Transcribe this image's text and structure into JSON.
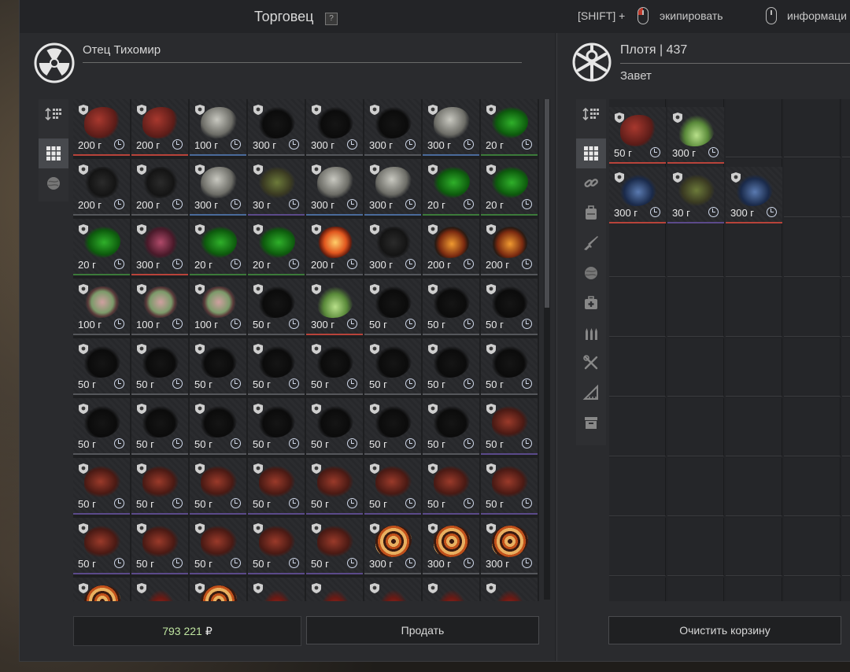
{
  "header": {
    "title": "Торговец",
    "help": "?",
    "hint_shift": "[SHIFT] +",
    "hint_equip": "экипировать",
    "hint_info": "информаци"
  },
  "trader": {
    "name": "Отец Тихомир"
  },
  "player": {
    "name": "Плотя | 437",
    "faction": "Завет"
  },
  "footer": {
    "money": "793 221",
    "currency": "₽",
    "sell_label": "Продать",
    "clear_label": "Очистить корзину"
  },
  "colors": {
    "accent_green": "#bfe5a0",
    "border_red": "#c0392b",
    "border_green": "#3c7a3a",
    "border_purple": "#5b4a8a"
  },
  "left_filters": [
    "sort-icon",
    "grid-icon",
    "artifact-icon"
  ],
  "right_filters": [
    "sort-icon",
    "grid-icon",
    "link-icon",
    "backpack-icon",
    "rifle-icon",
    "artifact-icon",
    "medkit-icon",
    "ammo-icon",
    "tools-icon",
    "misc-icon",
    "box-icon"
  ],
  "trader_items": [
    {
      "price": "200 г",
      "kind": "red"
    },
    {
      "price": "200 г",
      "kind": "red"
    },
    {
      "price": "100 г",
      "kind": "white"
    },
    {
      "price": "300 г",
      "kind": "black"
    },
    {
      "price": "300 г",
      "kind": "black"
    },
    {
      "price": "300 г",
      "kind": "black"
    },
    {
      "price": "300 г",
      "kind": "white"
    },
    {
      "price": "20 г",
      "kind": "green"
    },
    {
      "price": "200 г",
      "kind": "dark"
    },
    {
      "price": "200 г",
      "kind": "dark"
    },
    {
      "price": "300 г",
      "kind": "white"
    },
    {
      "price": "30 г",
      "kind": "moss"
    },
    {
      "price": "300 г",
      "kind": "white"
    },
    {
      "price": "300 г",
      "kind": "white"
    },
    {
      "price": "20 г",
      "kind": "green"
    },
    {
      "price": "20 г",
      "kind": "green"
    },
    {
      "price": "20 г",
      "kind": "green"
    },
    {
      "price": "300 г",
      "kind": "pink"
    },
    {
      "price": "20 г",
      "kind": "green"
    },
    {
      "price": "20 г",
      "kind": "green"
    },
    {
      "price": "200 г",
      "kind": "orange"
    },
    {
      "price": "300 г",
      "kind": "dark"
    },
    {
      "price": "200 г",
      "kind": "fire"
    },
    {
      "price": "200 г",
      "kind": "fire"
    },
    {
      "price": "100 г",
      "kind": "flower"
    },
    {
      "price": "100 г",
      "kind": "flower"
    },
    {
      "price": "100 г",
      "kind": "flower"
    },
    {
      "price": "50 г",
      "kind": "black"
    },
    {
      "price": "300 г",
      "kind": "crystal"
    },
    {
      "price": "50 г",
      "kind": "black"
    },
    {
      "price": "50 г",
      "kind": "black"
    },
    {
      "price": "50 г",
      "kind": "black"
    },
    {
      "price": "50 г",
      "kind": "black"
    },
    {
      "price": "50 г",
      "kind": "black"
    },
    {
      "price": "50 г",
      "kind": "black"
    },
    {
      "price": "50 г",
      "kind": "black"
    },
    {
      "price": "50 г",
      "kind": "black"
    },
    {
      "price": "50 г",
      "kind": "black"
    },
    {
      "price": "50 г",
      "kind": "black"
    },
    {
      "price": "50 г",
      "kind": "black"
    },
    {
      "price": "50 г",
      "kind": "black"
    },
    {
      "price": "50 г",
      "kind": "black"
    },
    {
      "price": "50 г",
      "kind": "black"
    },
    {
      "price": "50 г",
      "kind": "black"
    },
    {
      "price": "50 г",
      "kind": "black"
    },
    {
      "price": "50 г",
      "kind": "black"
    },
    {
      "price": "50 г",
      "kind": "black"
    },
    {
      "price": "50 г",
      "kind": "meat"
    },
    {
      "price": "50 г",
      "kind": "meat"
    },
    {
      "price": "50 г",
      "kind": "meat"
    },
    {
      "price": "50 г",
      "kind": "meat"
    },
    {
      "price": "50 г",
      "kind": "meat"
    },
    {
      "price": "50 г",
      "kind": "meat"
    },
    {
      "price": "50 г",
      "kind": "meat"
    },
    {
      "price": "50 г",
      "kind": "meat"
    },
    {
      "price": "50 г",
      "kind": "meat"
    },
    {
      "price": "50 г",
      "kind": "meat"
    },
    {
      "price": "50 г",
      "kind": "meat"
    },
    {
      "price": "50 г",
      "kind": "meat"
    },
    {
      "price": "50 г",
      "kind": "meat"
    },
    {
      "price": "50 г",
      "kind": "meat"
    },
    {
      "price": "300 г",
      "kind": "spiral"
    },
    {
      "price": "300 г",
      "kind": "spiral"
    },
    {
      "price": "300 г",
      "kind": "spiral"
    },
    {
      "price": "",
      "kind": "spiral"
    },
    {
      "price": "",
      "kind": "redspike"
    },
    {
      "price": "",
      "kind": "spiral"
    },
    {
      "price": "",
      "kind": "redspike"
    },
    {
      "price": "",
      "kind": "redspike"
    },
    {
      "price": "",
      "kind": "redspike"
    },
    {
      "price": "",
      "kind": "redspike"
    },
    {
      "price": "",
      "kind": "redspike"
    }
  ],
  "cart_items": [
    {
      "price": "50 г",
      "kind": "red"
    },
    {
      "price": "300 г",
      "kind": "crystal"
    },
    {
      "price": "300 г",
      "kind": "blue"
    },
    {
      "price": "30 г",
      "kind": "moss"
    },
    {
      "price": "300 г",
      "kind": "blue"
    }
  ]
}
